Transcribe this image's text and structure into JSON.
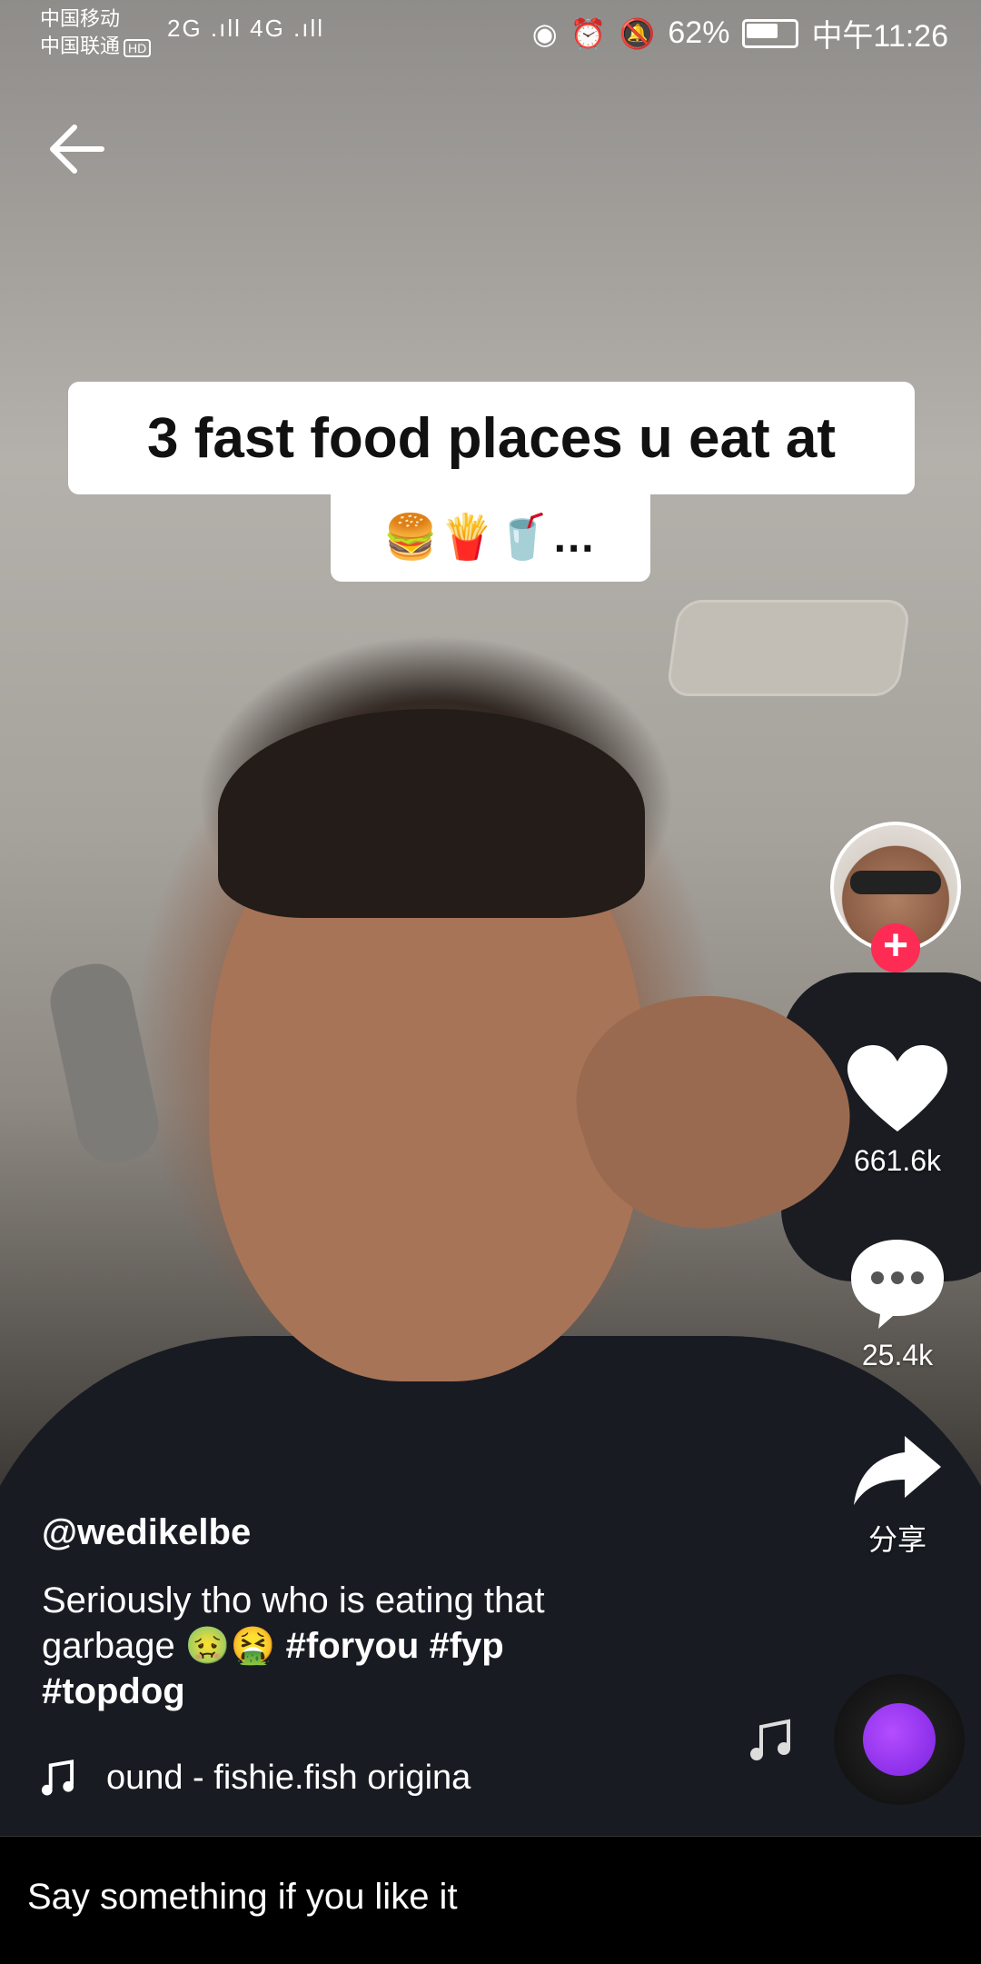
{
  "status_bar": {
    "carrier1": "中国移动",
    "carrier2": "中国联通",
    "hd_badge": "HD",
    "signal_text": "2G .ıll 4G .ıll",
    "battery_percent": "62%",
    "time": "中午11:26"
  },
  "video": {
    "caption_line1": "3 fast food places u eat at",
    "caption_line2": "🍔🍟🥤…"
  },
  "sidebar": {
    "like_count": "661.6k",
    "comment_count": "25.4k",
    "share_label": "分享",
    "follow_symbol": "+"
  },
  "post": {
    "username": "@wedikelbe",
    "description": "Seriously tho who is eating that garbage 🤢🤮",
    "hashtags": [
      "#foryou",
      "#fyp",
      "#topdog"
    ],
    "music_text": "ound - fishie.fish    origina"
  },
  "comment_bar": {
    "placeholder": "Say something if you like it"
  },
  "colors": {
    "accent_red": "#fe2c55",
    "disc_purple": "#9b3cf2",
    "bar_black": "#000000"
  }
}
